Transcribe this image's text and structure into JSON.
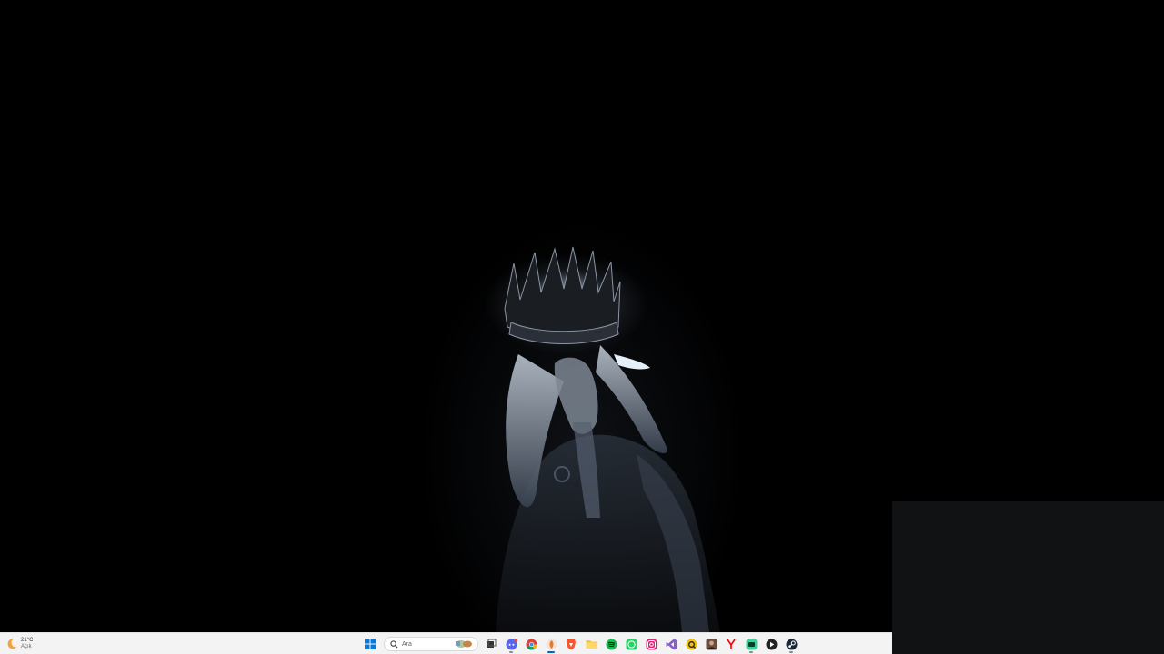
{
  "taskbar": {
    "weather": {
      "temperature": "21°C",
      "condition": "Açık",
      "icon": "moon-icon"
    },
    "search": {
      "placeholder": "Ara"
    },
    "apps": [
      {
        "name": "start",
        "icon": "windows-start-icon"
      },
      {
        "name": "task-view",
        "icon": "task-view-icon"
      },
      {
        "name": "discord",
        "icon": "discord-icon",
        "color": "#5865f2"
      },
      {
        "name": "chrome",
        "icon": "chrome-icon"
      },
      {
        "name": "app-orange",
        "icon": "orange-app-icon",
        "color": "#e8782a"
      },
      {
        "name": "brave",
        "icon": "brave-icon",
        "color": "#fb542b"
      },
      {
        "name": "file-explorer",
        "icon": "folder-icon",
        "color": "#f6c342"
      },
      {
        "name": "spotify",
        "icon": "spotify-icon",
        "color": "#1db954"
      },
      {
        "name": "whatsapp",
        "icon": "whatsapp-icon",
        "color": "#25d366"
      },
      {
        "name": "instagram",
        "icon": "instagram-icon",
        "color": "#d62976"
      },
      {
        "name": "visual-studio",
        "icon": "visual-studio-icon",
        "color": "#8661c5"
      },
      {
        "name": "app-yellow",
        "icon": "yellow-app-icon",
        "color": "#f4c20d"
      },
      {
        "name": "photo-app",
        "icon": "photo-app-icon",
        "color": "#6b4e3d"
      },
      {
        "name": "yandex",
        "icon": "yandex-icon",
        "color": "#ff0000"
      },
      {
        "name": "app-teal",
        "icon": "teal-app-icon",
        "color": "#3ecf9a"
      },
      {
        "name": "media-player",
        "icon": "play-icon",
        "color": "#222222"
      },
      {
        "name": "steam",
        "icon": "steam-icon",
        "color": "#1b2838"
      }
    ]
  }
}
